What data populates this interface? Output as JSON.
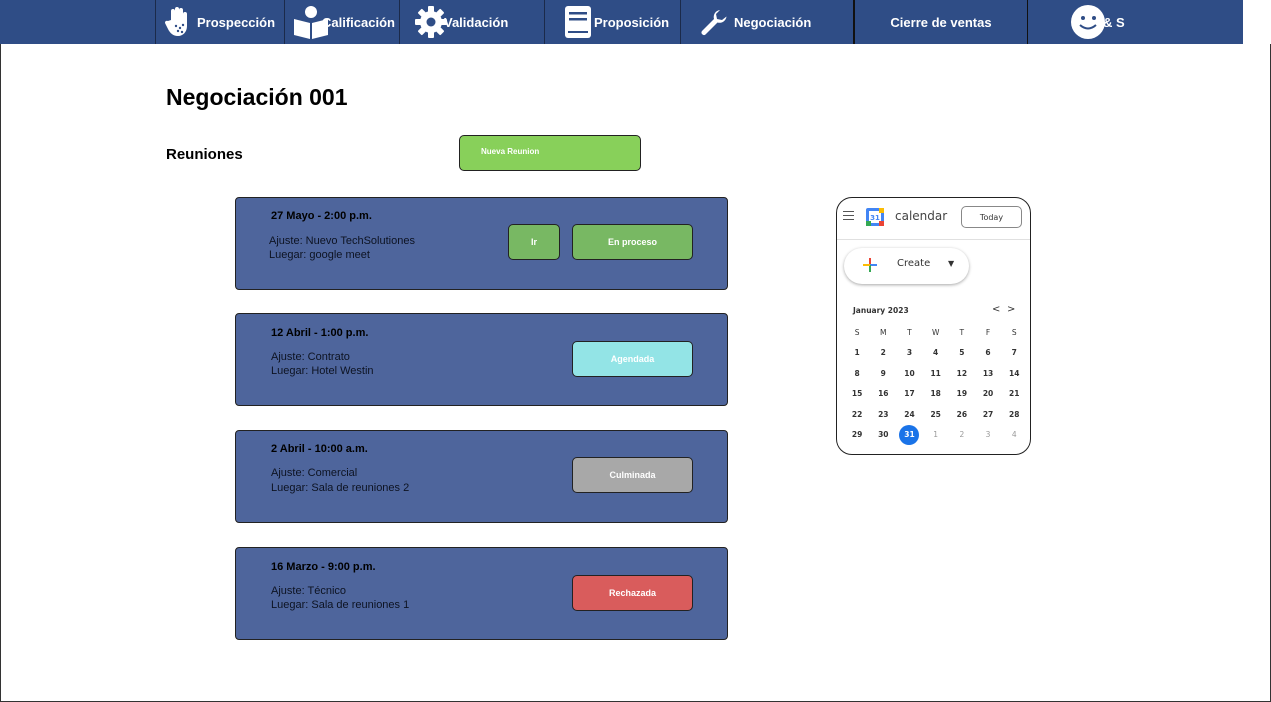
{
  "nav": {
    "items": [
      {
        "label": "Prospección",
        "icon": "hand-icon"
      },
      {
        "label": "Calificación",
        "icon": "reader-icon"
      },
      {
        "label": "Validación",
        "icon": "gear-icon"
      },
      {
        "label": "Proposición",
        "icon": "book-icon"
      },
      {
        "label": "Negociación",
        "icon": "wrench-icon"
      },
      {
        "label": "Cierre de ventas",
        "icon": ""
      },
      {
        "label": "& S",
        "icon": "smiley-icon"
      }
    ]
  },
  "page": {
    "title": "Negociación 001",
    "section": "Reuniones",
    "new_button": "Nueva Reunion"
  },
  "meetings": [
    {
      "date": "27 Mayo - 2:00 p.m.",
      "ajuste": "Ajuste: Nuevo TechSolutiones",
      "lugar": "Luegar: google meet",
      "go_label": "Ir",
      "status": "En proceso",
      "status_color": "#78b863"
    },
    {
      "date": "12 Abril - 1:00 p.m.",
      "ajuste": "Ajuste: Contrato",
      "lugar": "Luegar: Hotel Westin",
      "status": "Agendada",
      "status_color": "#93e4e6"
    },
    {
      "date": "2 Abril - 10:00 a.m.",
      "ajuste": "Ajuste: Comercial",
      "lugar": "Luegar: Sala de reuniones 2",
      "status": "Culminada",
      "status_color": "#a8a8a8"
    },
    {
      "date": "16 Marzo - 9:00 p.m.",
      "ajuste": "Ajuste: Técnico",
      "lugar": "Luegar: Sala de reuniones 1",
      "status": "Rechazada",
      "status_color": "#d95c5c"
    }
  ],
  "calendar": {
    "app_name": "calendar",
    "logo_number": "31",
    "today_label": "Today",
    "create_label": "Create",
    "month": "January 2023",
    "prev": "<",
    "next": ">",
    "weekdays": [
      "S",
      "M",
      "T",
      "W",
      "T",
      "F",
      "S"
    ],
    "weeks": [
      [
        "1",
        "2",
        "3",
        "4",
        "5",
        "6",
        "7"
      ],
      [
        "8",
        "9",
        "10",
        "11",
        "12",
        "13",
        "14"
      ],
      [
        "15",
        "16",
        "17",
        "18",
        "19",
        "20",
        "21"
      ],
      [
        "22",
        "23",
        "24",
        "25",
        "26",
        "27",
        "28"
      ],
      [
        "29",
        "30",
        "31",
        "1",
        "2",
        "3",
        "4"
      ]
    ],
    "selected": "31",
    "accent": "#1a73e8"
  },
  "colors": {
    "nav_bg": "#2f4d86",
    "card_bg": "#4e659c",
    "new_button_bg": "#88d05a"
  }
}
